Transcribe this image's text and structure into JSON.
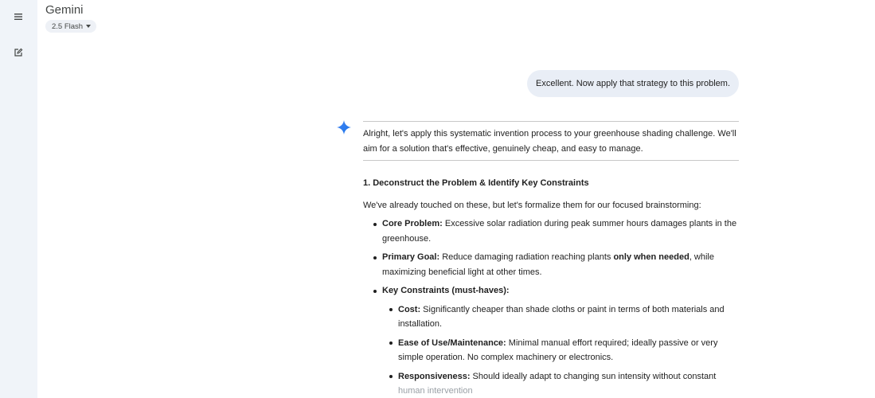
{
  "app": {
    "title": "Gemini",
    "model": "2.5 Flash"
  },
  "sidebar": {
    "icons": [
      "menu-icon",
      "new-chat-icon"
    ]
  },
  "user_message": "Excellent. Now apply that strategy to this problem.",
  "response": {
    "intro": "Alright, let's apply this systematic invention process to your greenhouse shading challenge. We'll aim for a solution that's effective, genuinely cheap, and easy to manage.",
    "section1_heading": "1. Deconstruct the Problem & Identify Key Constraints",
    "section1_lead": "We've already touched on these, but let's formalize them for our focused brainstorming:",
    "core_problem": {
      "label": "Core Problem:",
      "text": " Excessive solar radiation during peak summer hours damages plants in the greenhouse."
    },
    "primary_goal": {
      "label": "Primary Goal:",
      "text_a": " Reduce damaging radiation reaching plants ",
      "emph": "only when needed",
      "text_b": ", while maximizing beneficial light at other times."
    },
    "key_constraints": {
      "label": "Key Constraints (must-haves):"
    },
    "cost": {
      "label": "Cost:",
      "text": " Significantly cheaper than shade cloths or paint in terms of both materials and installation."
    },
    "ease": {
      "label": "Ease of Use/Maintenance:",
      "text": " Minimal manual effort required; ideally passive or very simple operation. No complex machinery or electronics."
    },
    "responsiveness": {
      "label": "Responsiveness:",
      "text_a": " Should ideally adapt to changing sun intensity without constant ",
      "text_b": "human intervention"
    }
  }
}
